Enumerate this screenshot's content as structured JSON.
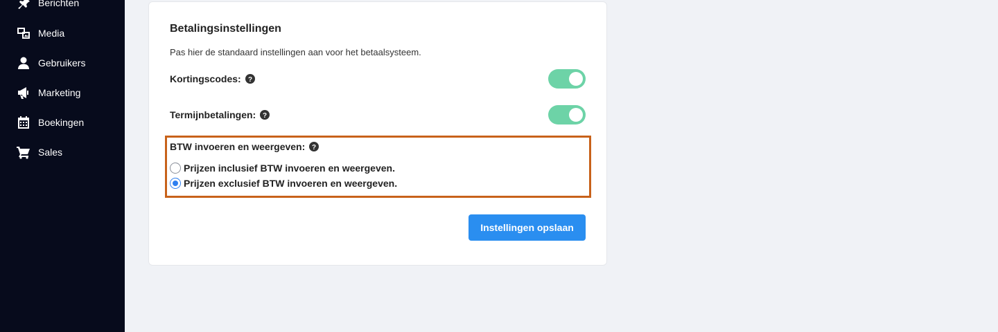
{
  "sidebar": {
    "items": [
      {
        "label": "Berichten",
        "icon": "pin-icon"
      },
      {
        "label": "Media",
        "icon": "media-icon"
      },
      {
        "label": "Gebruikers",
        "icon": "user-icon"
      },
      {
        "label": "Marketing",
        "icon": "megaphone-icon"
      },
      {
        "label": "Boekingen",
        "icon": "calendar-icon"
      },
      {
        "label": "Sales",
        "icon": "cart-icon"
      }
    ]
  },
  "card": {
    "title": "Betalingsinstellingen",
    "description": "Pas hier de standaard instellingen aan voor het betaalsysteem.",
    "settings": [
      {
        "label": "Kortingscodes:",
        "enabled": true
      },
      {
        "label": "Termijnbetalingen:",
        "enabled": true
      }
    ],
    "btw": {
      "label": "BTW invoeren en weergeven:",
      "options": [
        {
          "label": "Prijzen inclusief BTW invoeren en weergeven.",
          "checked": false
        },
        {
          "label": "Prijzen exclusief BTW invoeren en weergeven.",
          "checked": true
        }
      ]
    },
    "save_label": "Instellingen opslaan"
  },
  "colors": {
    "sidebar_bg": "#070b1c",
    "toggle_on": "#6dd3a7",
    "highlight_border": "#c8621a",
    "primary": "#2a8ef0"
  }
}
